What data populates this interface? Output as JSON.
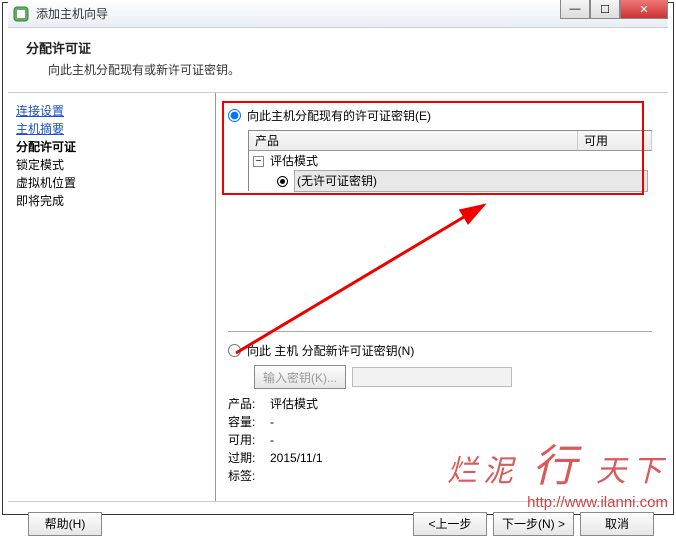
{
  "window": {
    "title": "添加主机向导"
  },
  "header": {
    "title": "分配许可证",
    "subtitle": "向此主机分配现有或新许可证密钥。"
  },
  "sidebar": {
    "items": [
      {
        "label": "连接设置",
        "type": "link"
      },
      {
        "label": "主机摘要",
        "type": "link"
      },
      {
        "label": "分配许可证",
        "type": "bold"
      },
      {
        "label": "锁定模式",
        "type": "plain"
      },
      {
        "label": "虚拟机位置",
        "type": "plain"
      },
      {
        "label": "即将完成",
        "type": "plain"
      }
    ]
  },
  "content": {
    "radio_existing": "向此主机分配现有的许可证密钥(E)",
    "table": {
      "col_product": "产品",
      "col_available": "可用",
      "row_mode": "评估模式",
      "row_nokey": "(无许可证密钥)"
    },
    "radio_new": "向此 主机 分配新许可证密钥(N)",
    "key_button": "输入密钥(K)...",
    "info": {
      "product_label": "产品:",
      "product_value": "评估模式",
      "capacity_label": "容量:",
      "capacity_value": "-",
      "available_label": "可用:",
      "available_value": "-",
      "expires_label": "过期:",
      "expires_value": "2015/11/1",
      "tag_label": "标签:",
      "tag_value": ""
    }
  },
  "footer": {
    "help": "帮助(H)",
    "back": "<上一步",
    "next": "下一步(N) >",
    "cancel": "取消"
  },
  "watermark": {
    "line1a": "烂泥",
    "line1b": "行",
    "line1c": "天下",
    "line2": "http://www.ilanni.com"
  }
}
